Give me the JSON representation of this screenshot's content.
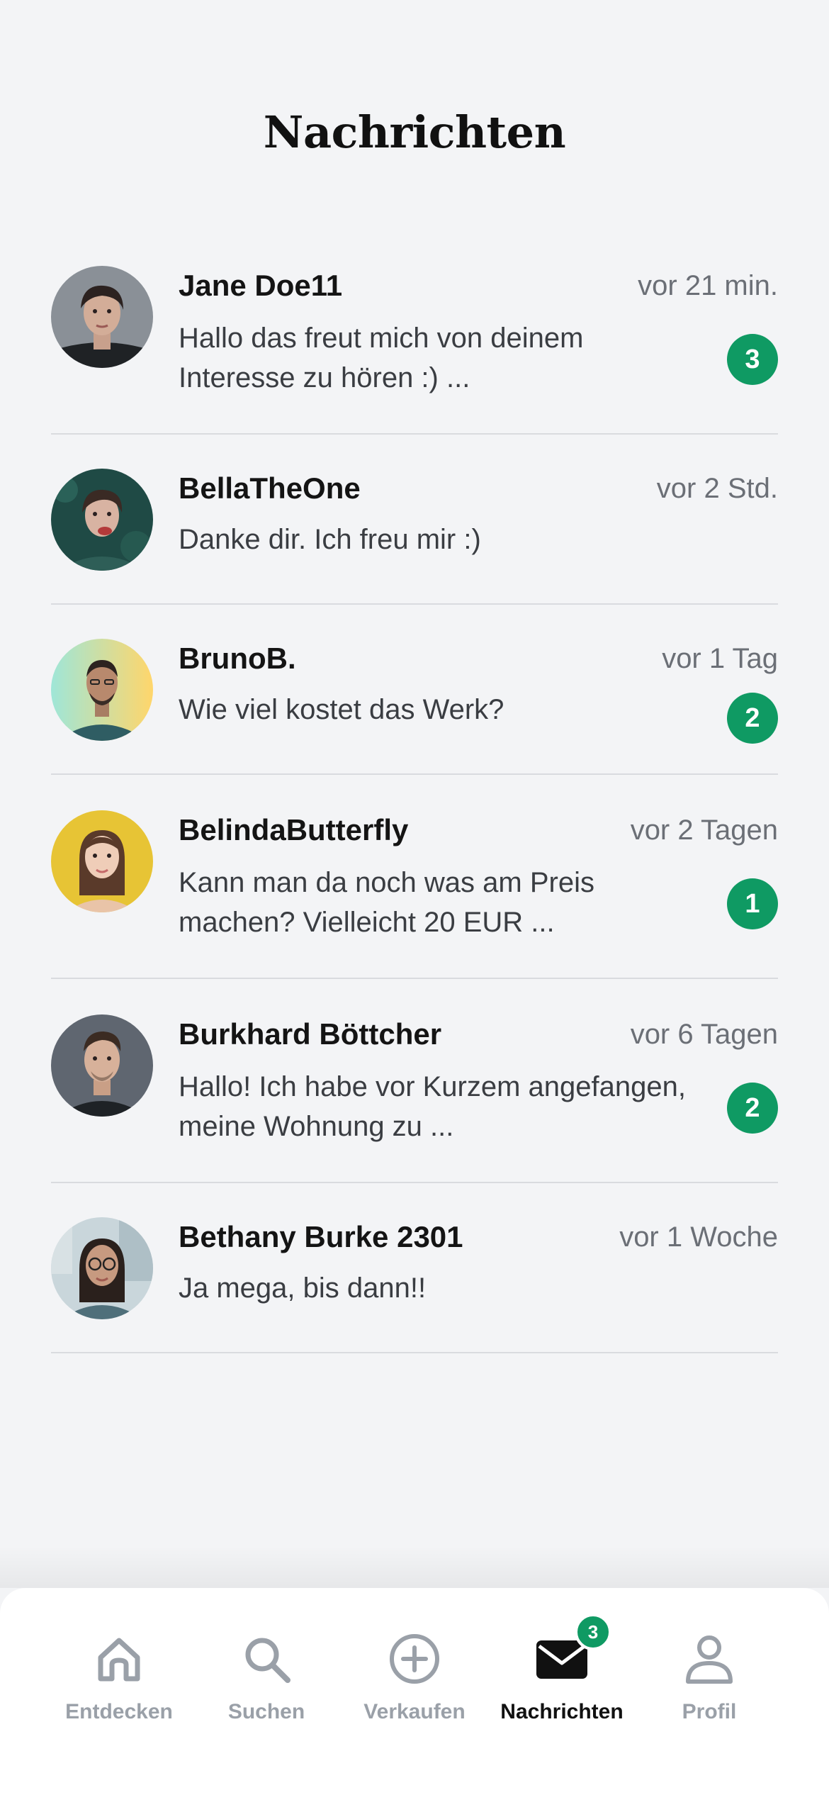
{
  "header": {
    "title": "Nachrichten"
  },
  "conversations": [
    {
      "name": "Jane Doe11",
      "time": "vor 21 min.",
      "preview": "Hallo das freut mich von deinem Interesse zu hören :) ...",
      "unread": "3"
    },
    {
      "name": "BellaTheOne",
      "time": "vor 2 Std.",
      "preview": "Danke dir. Ich freu mir :)",
      "unread": ""
    },
    {
      "name": "BrunoB.",
      "time": "vor 1 Tag",
      "preview": "Wie viel kostet das Werk?",
      "unread": "2"
    },
    {
      "name": "BelindaButterfly",
      "time": "vor 2 Tagen",
      "preview": "Kann man da noch was am Preis machen? Vielleicht 20 EUR ...",
      "unread": "1"
    },
    {
      "name": "Burkhard Böttcher",
      "time": "vor 6 Tagen",
      "preview": "Hallo! Ich habe vor Kurzem angefangen, meine Wohnung zu ...",
      "unread": "2"
    },
    {
      "name": "Bethany Burke 2301",
      "time": "vor 1 Woche",
      "preview": "Ja mega, bis dann!!",
      "unread": ""
    }
  ],
  "tab_bar": {
    "tabs": [
      {
        "label": "Entdecken",
        "icon": "home-icon",
        "active": false
      },
      {
        "label": "Suchen",
        "icon": "search-icon",
        "active": false
      },
      {
        "label": "Verkaufen",
        "icon": "plus-circle-icon",
        "active": false
      },
      {
        "label": "Nachrichten",
        "icon": "mail-icon",
        "active": true,
        "badge": "3"
      },
      {
        "label": "Profil",
        "icon": "user-icon",
        "active": false
      }
    ]
  },
  "colors": {
    "background": "#f3f4f6",
    "accent_green": "#0f9a63",
    "text_primary": "#111111",
    "text_secondary": "#6b6f76",
    "tab_inactive": "#9aa0a8"
  }
}
